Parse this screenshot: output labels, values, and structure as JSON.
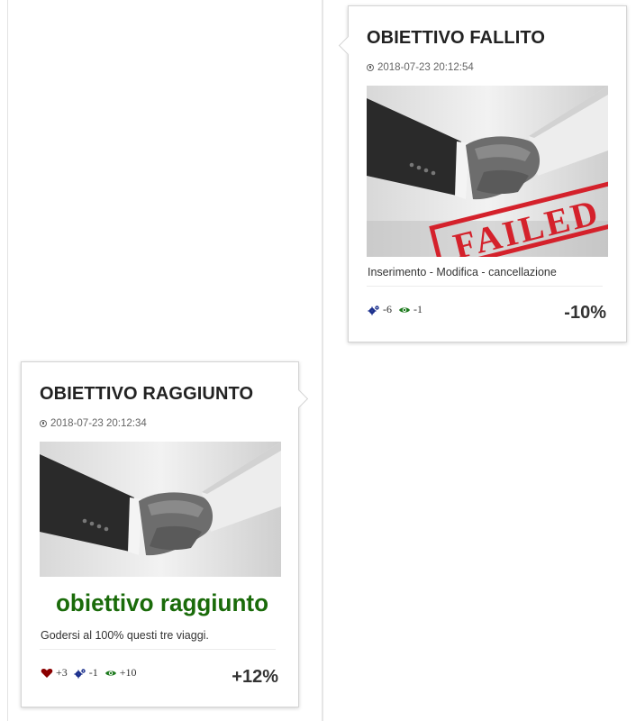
{
  "cards": [
    {
      "title": "OBIETTIVO FALLITO",
      "date": "2018-07-23 20:12:54",
      "image_stamp": "FAILED",
      "description": "Inserimento - Modifica - cancellazione",
      "stats": [
        {
          "icon": "cogs-icon",
          "value": "-6"
        },
        {
          "icon": "eye-icon",
          "value": "-1"
        }
      ],
      "percent": "-10%"
    },
    {
      "title": "OBIETTIVO RAGGIUNTO",
      "date": "2018-07-23 20:12:34",
      "image_caption": "obiettivo raggiunto",
      "description": "Godersi al 100% questi tre viaggi.",
      "stats": [
        {
          "icon": "heart-icon",
          "value": "+3"
        },
        {
          "icon": "cogs-icon",
          "value": "-1"
        },
        {
          "icon": "eye-icon",
          "value": "+10"
        }
      ],
      "percent": "+12%"
    }
  ],
  "colors": {
    "heart": "#8b0000",
    "cogs": "#1a2f8c",
    "eye": "#1d7a1d",
    "stamp": "#d4212b",
    "caption": "#1a6b0a"
  }
}
